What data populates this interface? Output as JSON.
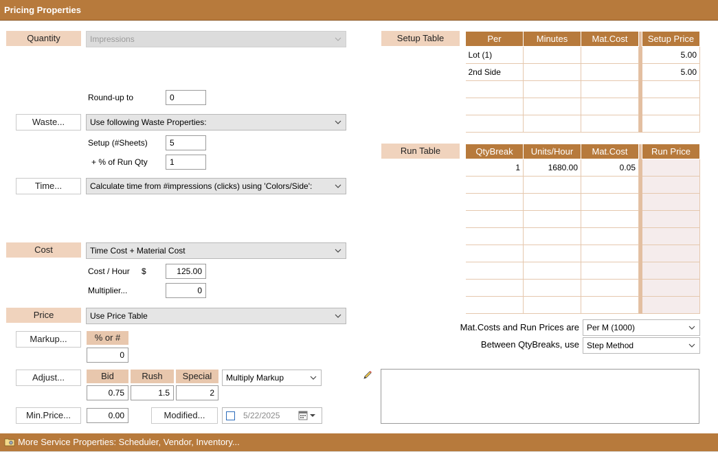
{
  "title": "Pricing Properties",
  "footer": {
    "label": "More Service Properties: Scheduler, Vendor, Inventory...",
    "icon": "folder-settings-icon"
  },
  "quantity": {
    "label": "Quantity",
    "value": "Impressions"
  },
  "roundup": {
    "label": "Round-up to",
    "value": "0"
  },
  "waste": {
    "button": "Waste...",
    "mode": "Use following Waste Properties:",
    "setup_label": "Setup (#Sheets)",
    "setup_value": "5",
    "run_label": "+ % of Run Qty",
    "run_value": "1"
  },
  "time": {
    "button": "Time...",
    "mode": "Calculate time from #impressions (clicks) using 'Colors/Side':"
  },
  "cost": {
    "label": "Cost",
    "mode": "Time Cost + Material Cost",
    "hour_label": "Cost / Hour",
    "currency": "$",
    "hour_value": "125.00",
    "mult_label": "Multiplier...",
    "mult_value": "0"
  },
  "price": {
    "label": "Price",
    "mode": "Use Price Table"
  },
  "markup": {
    "button": "Markup...",
    "header": "% or #",
    "value": "0"
  },
  "adjust": {
    "button": "Adjust...",
    "bid_label": "Bid",
    "bid_value": "0.75",
    "rush_label": "Rush",
    "rush_value": "1.5",
    "special_label": "Special",
    "special_value": "2",
    "mode": "Multiply Markup"
  },
  "minprice": {
    "button": "Min.Price...",
    "value": "0.00"
  },
  "modified": {
    "button": "Modified...",
    "date": "5/22/2025",
    "checked": false
  },
  "setup_table": {
    "label": "Setup Table",
    "headers": [
      "Per",
      "Minutes",
      "Mat.Cost",
      "Setup Price"
    ],
    "rows": [
      [
        "Lot (1)",
        "",
        "",
        "5.00"
      ],
      [
        "2nd Side",
        "",
        "",
        "5.00"
      ],
      [
        "",
        "",
        "",
        ""
      ],
      [
        "",
        "",
        "",
        ""
      ],
      [
        "",
        "",
        "",
        ""
      ]
    ]
  },
  "run_table": {
    "label": "Run Table",
    "headers": [
      "QtyBreak",
      "Units/Hour",
      "Mat.Cost",
      "Run Price"
    ],
    "rows": [
      [
        "1",
        "1680.00",
        "0.05",
        ""
      ],
      [
        "",
        "",
        "",
        ""
      ],
      [
        "",
        "",
        "",
        ""
      ],
      [
        "",
        "",
        "",
        ""
      ],
      [
        "",
        "",
        "",
        ""
      ],
      [
        "",
        "",
        "",
        ""
      ],
      [
        "",
        "",
        "",
        ""
      ],
      [
        "",
        "",
        "",
        ""
      ],
      [
        "",
        "",
        "",
        ""
      ]
    ]
  },
  "matcosts": {
    "label": "Mat.Costs and Run Prices are",
    "value": "Per M (1000)"
  },
  "between": {
    "label": "Between QtyBreaks, use",
    "value": "Step Method"
  },
  "colors": {
    "accent": "#b77a3c",
    "label_bg": "#f0d3bd",
    "header_bg": "#e8c7ad"
  }
}
